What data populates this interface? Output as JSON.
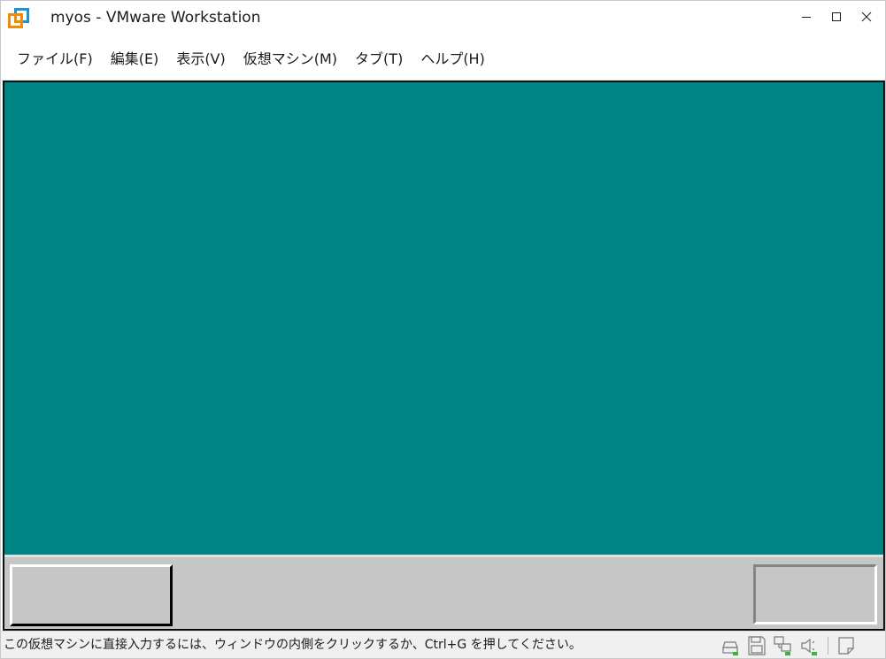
{
  "window": {
    "title": "myos - VMware Workstation",
    "icon": "vmware-logo-icon"
  },
  "controls": {
    "minimize_icon": "minimize-icon",
    "maximize_icon": "maximize-icon",
    "close_icon": "close-icon"
  },
  "menu": {
    "items": [
      {
        "label": "ファイル(F)"
      },
      {
        "label": "編集(E)"
      },
      {
        "label": "表示(V)"
      },
      {
        "label": "仮想マシン(M)"
      },
      {
        "label": "タブ(T)"
      },
      {
        "label": "ヘルプ(H)"
      }
    ]
  },
  "vm": {
    "desktop_color": "#008585",
    "taskbar_color": "#c6c6c6"
  },
  "status": {
    "text": "この仮想マシンに直接入力するには、ウィンドウの内側をクリックするか、Ctrl+G を押してください。",
    "icons": [
      "hard-disk-icon",
      "floppy-icon",
      "network-icon",
      "sound-icon",
      "message-icon"
    ],
    "activity_color": "#3cb43c"
  },
  "colors": {
    "vmware_orange": "#f38b00",
    "vmware_blue": "#1d93d2"
  }
}
